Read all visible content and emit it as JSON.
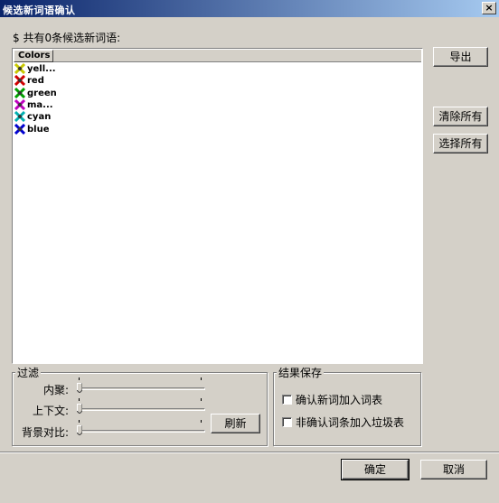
{
  "window": {
    "title": "候选新词语确认",
    "close_glyph": "×"
  },
  "summary": {
    "text": "$ 共有0条候选新词语:"
  },
  "list": {
    "column_header": "Colors",
    "items": [
      {
        "label": "yell...",
        "color": "#c8c800",
        "icon": "yellow-flower-icon"
      },
      {
        "label": "red",
        "color": "#d00000",
        "icon": "red-flower-icon"
      },
      {
        "label": "green",
        "color": "#00a000",
        "icon": "green-flower-icon"
      },
      {
        "label": "ma...",
        "color": "#c000c0",
        "icon": "magenta-flower-icon"
      },
      {
        "label": "cyan",
        "color": "#00b0b0",
        "icon": "cyan-flower-icon"
      },
      {
        "label": "blue",
        "color": "#0000d0",
        "icon": "blue-flower-icon"
      }
    ]
  },
  "buttons": {
    "export": "导出",
    "clear_all": "清除所有",
    "select_all": "选择所有",
    "refresh": "刷新",
    "ok": "确定",
    "cancel": "取消"
  },
  "filter": {
    "title": "过滤",
    "sliders": [
      {
        "label": "内聚:",
        "value": 0
      },
      {
        "label": "上下文:",
        "value": 0
      },
      {
        "label": "背景对比:",
        "value": 0
      }
    ]
  },
  "save": {
    "title": "结果保存",
    "options": [
      {
        "label": "确认新词加入词表",
        "checked": false
      },
      {
        "label": "非确认词条加入垃圾表",
        "checked": false
      }
    ]
  }
}
